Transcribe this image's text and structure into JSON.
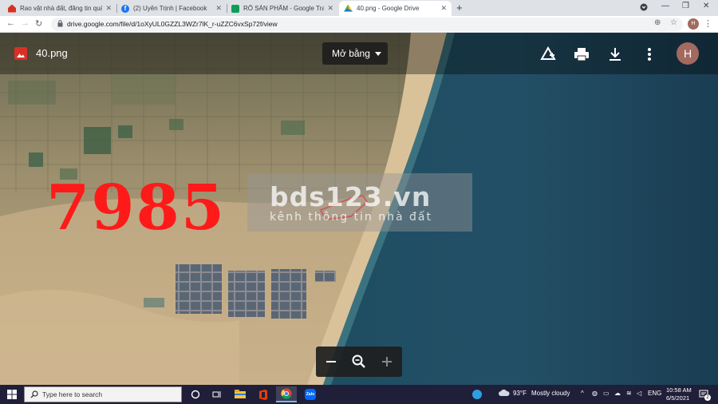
{
  "browser": {
    "tabs": [
      {
        "title": "Rao vặt nhà đất, đăng tin quảng",
        "icon": "home-icon"
      },
      {
        "title": "(2) Uyên Trịnh | Facebook",
        "icon": "facebook-icon"
      },
      {
        "title": "RỔ SẢN PHẨM - Google Trang tính",
        "icon": "sheets-icon"
      },
      {
        "title": "40.png - Google Drive",
        "icon": "drive-icon",
        "active": true
      }
    ],
    "url": "drive.google.com/file/d/1oXyUL0GZZL3WZr7lK_r-uZZC6vxSp72f/view",
    "profile_initial": "H"
  },
  "viewer": {
    "file_name": "40.png",
    "open_with_label": "Mở bằng",
    "avatar_initial": "H"
  },
  "image_overlay": {
    "listing_number": "7985",
    "watermark_brand": "bds123.vn",
    "watermark_slogan": "kênh thông tin nhà đất",
    "highlight_color": "#e53935"
  },
  "taskbar": {
    "search_placeholder": "Type here to search",
    "weather_temp": "93°F",
    "weather_text": "Mostly cloudy",
    "language": "ENG",
    "time": "10:58 AM",
    "date": "6/5/2021",
    "notification_count": "2"
  }
}
